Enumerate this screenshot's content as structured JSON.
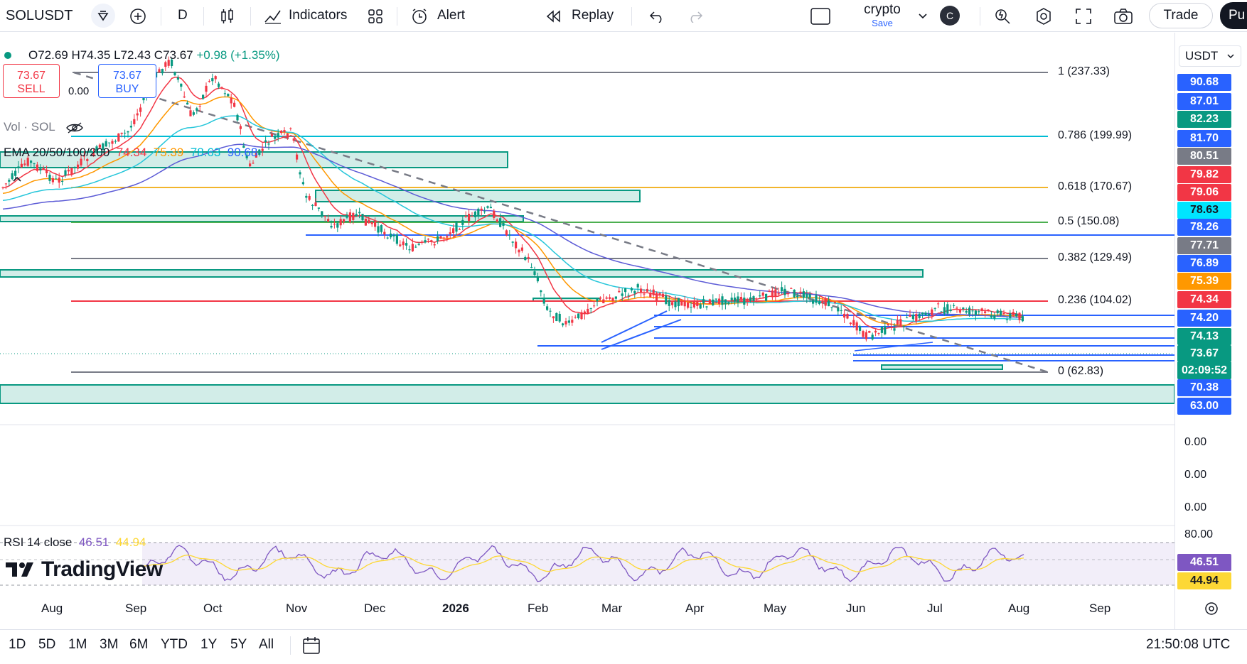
{
  "toolbar": {
    "symbol": "SOLUSDT",
    "interval": "D",
    "indicators_label": "Indicators",
    "alert_label": "Alert",
    "replay_label": "Replay",
    "layout_name": "crypto",
    "layout_sub": "Save",
    "avatar_letter": "C",
    "trade_label": "Trade",
    "publish_label": "Pu"
  },
  "legend": {
    "open": "O72.69",
    "high": "H74.35",
    "low": "L72.43",
    "close": "C73.67",
    "change": "+0.98 (+1.35%)",
    "sell_price": "73.67",
    "sell_label": "SELL",
    "buy_price": "73.67",
    "buy_label": "BUY",
    "spread": "0.00",
    "vol_label": "Vol · SOL",
    "ema_label": "EMA 20/50/100/200",
    "ema_values": [
      "74.34",
      "75.39",
      "78.63",
      "90.68"
    ],
    "rsi_label": "RSI 14 close",
    "rsi_values": [
      "46.51",
      "44.94"
    ]
  },
  "currency": "USDT",
  "fib_levels": [
    {
      "label": "1 (237.33)",
      "color": "#787b86"
    },
    {
      "label": "0.786 (199.99)",
      "color": "#00bcd4"
    },
    {
      "label": "0.618 (170.67)",
      "color": "#f2b52c"
    },
    {
      "label": "0.5 (150.08)",
      "color": "#4caf50"
    },
    {
      "label": "0.382 (129.49)",
      "color": "#787b86"
    },
    {
      "label": "0.236 (104.02)",
      "color": "#f23645"
    },
    {
      "label": "0 (62.83)",
      "color": "#787b86"
    }
  ],
  "price_labels": [
    {
      "v": "90.68",
      "bg": "#2962ff"
    },
    {
      "v": "87.01",
      "bg": "#2962ff"
    },
    {
      "v": "82.23",
      "bg": "#089981"
    },
    {
      "v": "81.70",
      "bg": "#2962ff"
    },
    {
      "v": "80.51",
      "bg": "#787b86"
    },
    {
      "v": "79.82",
      "bg": "#f23645"
    },
    {
      "v": "79.06",
      "bg": "#f23645"
    },
    {
      "v": "78.63",
      "bg": "#00e5ff"
    },
    {
      "v": "78.26",
      "bg": "#2962ff"
    },
    {
      "v": "77.71",
      "bg": "#787b86"
    },
    {
      "v": "76.89",
      "bg": "#2962ff"
    },
    {
      "v": "75.39",
      "bg": "#ff9800"
    },
    {
      "v": "74.34",
      "bg": "#f23645"
    },
    {
      "v": "74.20",
      "bg": "#2962ff"
    },
    {
      "v": "74.13",
      "bg": "#089981"
    },
    {
      "v": "73.67",
      "bg": "#089981"
    },
    {
      "v": "02:09:52",
      "bg": "#089981"
    },
    {
      "v": "70.38",
      "bg": "#2962ff"
    },
    {
      "v": "63.00",
      "bg": "#2962ff"
    }
  ],
  "axis_plain": [
    "0.00",
    "0.00",
    "0.00",
    "80.00"
  ],
  "rsi_labels": [
    {
      "v": "46.51",
      "bg": "#7e57c2"
    },
    {
      "v": "44.94",
      "bg": "#fdd835"
    }
  ],
  "time_labels": [
    "Aug",
    "Sep",
    "Oct",
    "Nov",
    "Dec",
    "2026",
    "Feb",
    "Mar",
    "Apr",
    "May",
    "Jun",
    "Jul",
    "Aug",
    "Sep"
  ],
  "ranges": [
    "1D",
    "5D",
    "1M",
    "3M",
    "6M",
    "YTD",
    "1Y",
    "5Y",
    "All"
  ],
  "clock": "21:50:08 UTC",
  "brand": "TradingView",
  "colors": {
    "up": "#089981",
    "down": "#f23645",
    "accent": "#2962ff"
  }
}
